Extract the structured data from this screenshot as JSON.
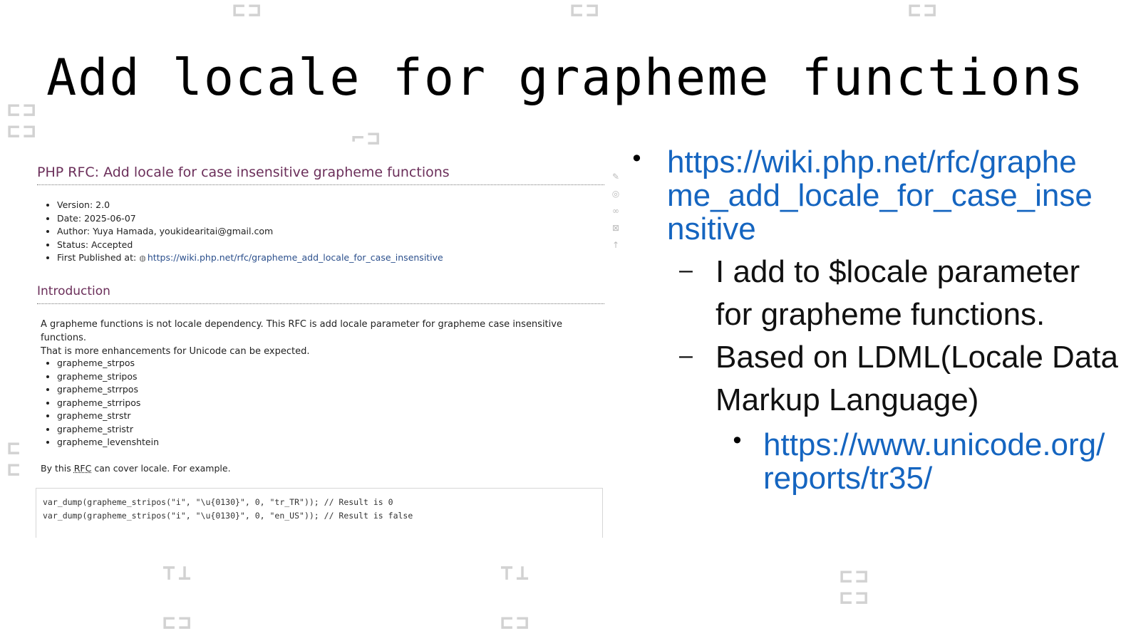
{
  "slide": {
    "title": "Add locale for grapheme functions"
  },
  "screenshot": {
    "heading": "PHP RFC: Add locale for case insensitive grapheme functions",
    "meta": [
      {
        "label": "Version:",
        "value": "2.0"
      },
      {
        "label": "Date:",
        "value": "2025-06-07"
      },
      {
        "label": "Author:",
        "value": "Yuya Hamada, youkidearitai@gmail.com"
      },
      {
        "label": "Status:",
        "value": "Accepted"
      },
      {
        "label": "First Published at:",
        "value": "https://wiki.php.net/rfc/grapheme_add_locale_for_case_insensitive"
      }
    ],
    "intro_heading": "Introduction",
    "intro_line1": "A grapheme functions is not locale dependency. This RFC is add locale parameter for grapheme case insensitive functions.",
    "intro_line2": "That is more enhancements for Unicode can be expected.",
    "functions": [
      "grapheme_strpos",
      "grapheme_stripos",
      "grapheme_strrpos",
      "grapheme_strripos",
      "grapheme_strstr",
      "grapheme_stristr",
      "grapheme_levenshtein"
    ],
    "example_prefix": "By this",
    "example_abbr": "RFC",
    "example_suffix": "can cover locale. For example.",
    "code_lines": [
      "var_dump(grapheme_stripos(\"i\", \"\\u{0130}\", 0, \"tr_TR\")); // Result is 0",
      "var_dump(grapheme_stripos(\"i\", \"\\u{0130}\", 0, \"en_US\")); // Result is false"
    ]
  },
  "bullets": {
    "rfc_link": "https://wiki.php.net/rfc/grapheme_add_locale_for_case_insensitive",
    "sub1": "I add to $locale parameter for grapheme functions.",
    "sub2": "Based on LDML(Locale Data Markup Language)",
    "ldml_link": "https://www.unicode.org/reports/tr35/"
  },
  "colors": {
    "link": "#1565c0",
    "rfc_heading": "#6b2f5a"
  }
}
